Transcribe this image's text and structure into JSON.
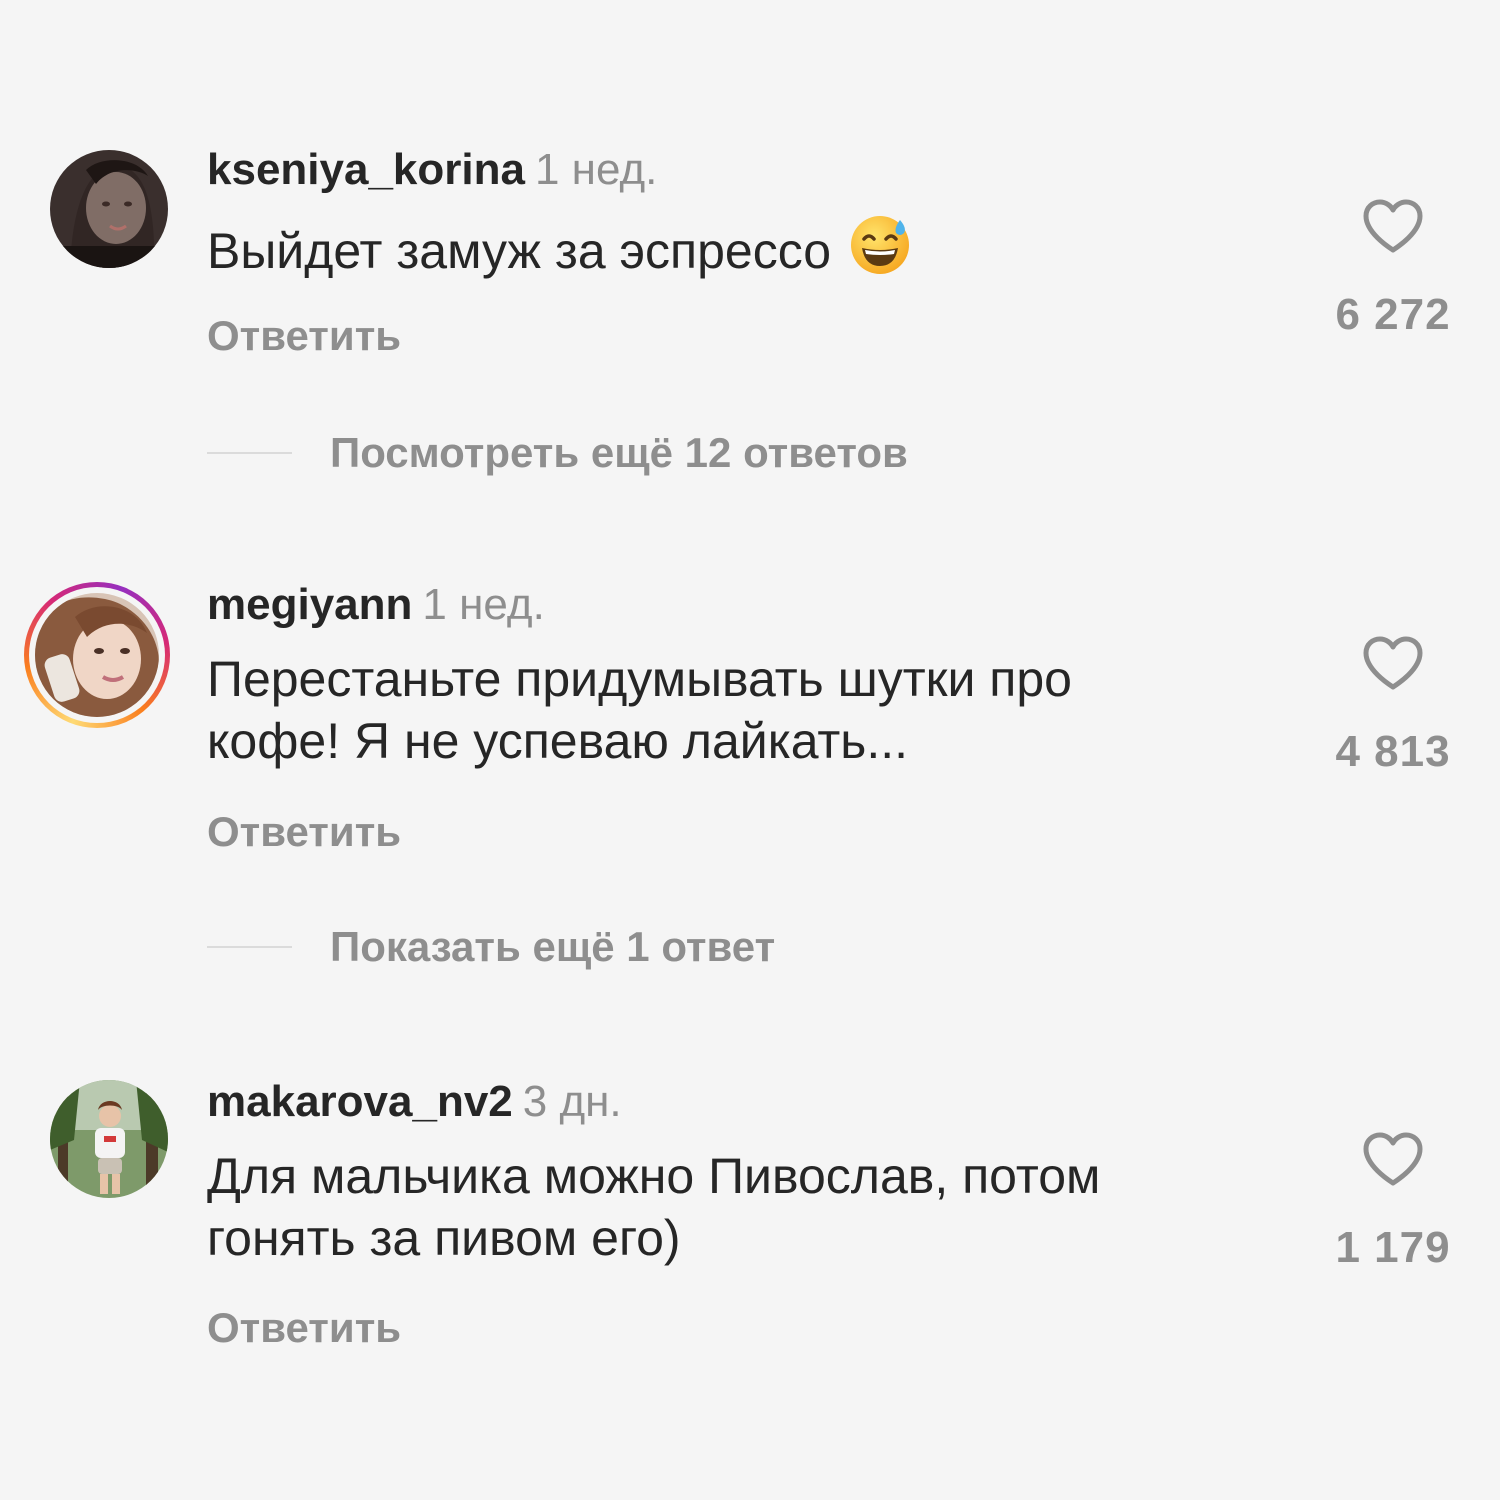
{
  "comments": [
    {
      "username": "kseniya_korina",
      "time": "1 нед.",
      "text": "Выйдет замуж за эспрессо",
      "emoji": "grinning-face-with-sweat",
      "reply_label": "Ответить",
      "likes": "6 272",
      "avatar_story_ring": false
    },
    {
      "username": "megiyann",
      "time": "1 нед.",
      "text": "Перестаньте придумывать шутки про кофе! Я не успеваю лайкать...",
      "reply_label": "Ответить",
      "likes": "4 813",
      "avatar_story_ring": true
    },
    {
      "username": "makarova_nv2",
      "time": "3 дн.",
      "text": "Для мальчика можно Пивослав, потом гонять за пивом его)",
      "reply_label": "Ответить",
      "likes": "1 179",
      "avatar_story_ring": false
    }
  ],
  "threads": [
    {
      "label": "Посмотреть ещё 12 ответов"
    },
    {
      "label": "Показать ещё 1 ответ"
    }
  ],
  "colors": {
    "background": "#f5f5f5",
    "primary_text": "#262626",
    "secondary_text": "#8e8e8e",
    "divider": "#dbdbdb",
    "story_ring": [
      "#feda75",
      "#fa7e1e",
      "#d62976",
      "#962fbf"
    ]
  },
  "icons": {
    "like": "heart-outline-icon"
  }
}
